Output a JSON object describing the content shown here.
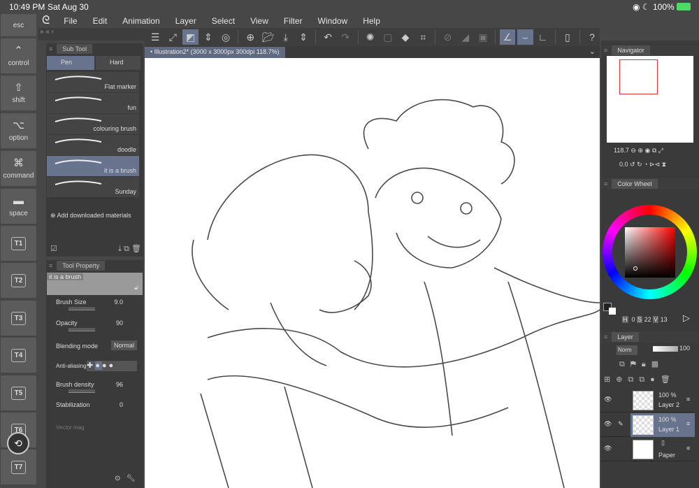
{
  "status": {
    "time": "10:49 PM",
    "date": "Sat Aug 30",
    "battery": "100%"
  },
  "keys": [
    {
      "glyph": "↺",
      "label": "esc"
    },
    {
      "glyph": "⌃",
      "label": "control"
    },
    {
      "glyph": "⇧",
      "label": "shift"
    },
    {
      "glyph": "⌥",
      "label": "option"
    },
    {
      "glyph": "⌘",
      "label": "command"
    },
    {
      "glyph": "▬",
      "label": "space"
    },
    {
      "label": "T1"
    },
    {
      "label": "T2"
    },
    {
      "label": "T3"
    },
    {
      "label": "T4"
    },
    {
      "label": "T5"
    },
    {
      "label": "T6"
    },
    {
      "label": "T7"
    }
  ],
  "menu": [
    "File",
    "Edit",
    "Animation",
    "Layer",
    "Select",
    "View",
    "Filter",
    "Window",
    "Help"
  ],
  "subtool": {
    "title": "Sub Tool",
    "tabs": [
      "Pen",
      "Hard"
    ],
    "brushes": [
      "Flat marker",
      "fun",
      "colouring brush",
      "doodle",
      "it is a brush",
      "Sunday"
    ],
    "selected": 4,
    "add_label": "Add downloaded materials"
  },
  "toolprop": {
    "title": "Tool Property",
    "preview_name": "it is a brush",
    "brush_size_label": "Brush Size",
    "brush_size": "9.0",
    "opacity_label": "Opacity",
    "opacity": "90",
    "blending_label": "Blending mode",
    "blending": "Normal",
    "antialias_label": "Anti-aliasing",
    "density_label": "Brush density",
    "density": "96",
    "stabilization_label": "Stabilization",
    "stabilization": "0",
    "vector_label": "Vector mag"
  },
  "document": {
    "tab": "Illustration2* (3000 x 3000px 300dpi 118.7%)"
  },
  "navigator": {
    "title": "Navigator",
    "zoom": "118.7",
    "rotation": "0.0"
  },
  "color": {
    "title": "Color Wheel",
    "h_label": "H",
    "h": "0",
    "s_label": "S",
    "s": "22",
    "v_label": "V",
    "v": "13",
    "accent": "#68738d"
  },
  "layer": {
    "title": "Layer",
    "blend": "Norm",
    "opacity": "100",
    "layers": [
      {
        "opacity": "100 %",
        "mode": "N",
        "name": "Layer 2"
      },
      {
        "opacity": "100 %",
        "mode": "N",
        "name": "Layer 1",
        "selected": true
      },
      {
        "name": "Paper"
      }
    ]
  }
}
